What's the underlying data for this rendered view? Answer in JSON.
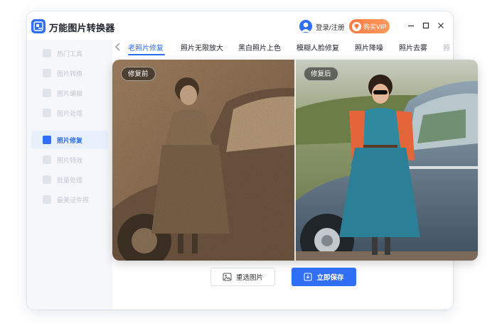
{
  "app": {
    "title": "万能图片转换器"
  },
  "header": {
    "login_label": "登录/注册",
    "vip_label": "购买VIP"
  },
  "sidebar": {
    "items": [
      {
        "label": "热门工具",
        "active": false
      },
      {
        "label": "图片转换",
        "active": false
      },
      {
        "label": "图片编辑",
        "active": false
      },
      {
        "label": "图片处理",
        "active": false
      },
      {
        "label": "照片修复",
        "active": true
      },
      {
        "label": "照片特效",
        "active": false
      },
      {
        "label": "批量处理",
        "active": false
      },
      {
        "label": "最美证件照",
        "active": false
      }
    ]
  },
  "tabs": [
    {
      "label": "老照片修复",
      "active": true
    },
    {
      "label": "照片无限放大",
      "active": false
    },
    {
      "label": "黑白照片上色",
      "active": false
    },
    {
      "label": "模糊人脸修复",
      "active": false
    },
    {
      "label": "照片降噪",
      "active": false
    },
    {
      "label": "照片去雾",
      "active": false
    },
    {
      "label": "照",
      "active": false
    }
  ],
  "compare": {
    "before_label": "修复前",
    "after_label": "修复后"
  },
  "actions": {
    "reselect_label": "重选图片",
    "save_label": "立即保存"
  },
  "colors": {
    "accent": "#2f6ef5",
    "vip": "#ff8a50"
  }
}
